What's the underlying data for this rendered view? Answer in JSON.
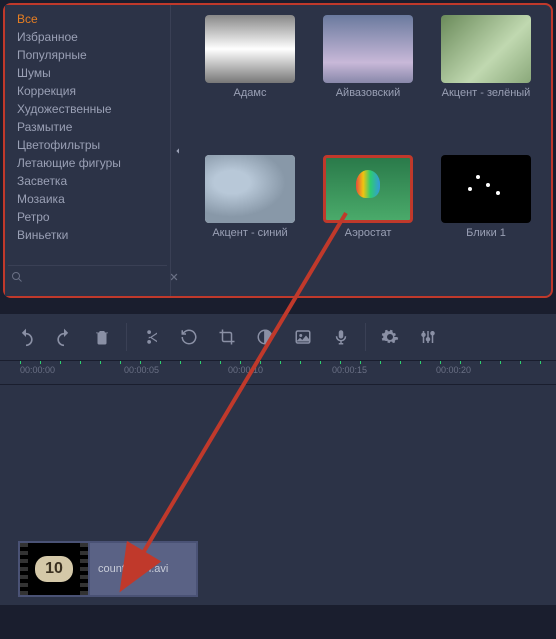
{
  "sidebar": {
    "categories": [
      {
        "label": "Все",
        "active": true
      },
      {
        "label": "Избранное",
        "active": false
      },
      {
        "label": "Популярные",
        "active": false
      },
      {
        "label": "Шумы",
        "active": false
      },
      {
        "label": "Коррекция",
        "active": false
      },
      {
        "label": "Художественные",
        "active": false
      },
      {
        "label": "Размытие",
        "active": false
      },
      {
        "label": "Цветофильтры",
        "active": false
      },
      {
        "label": "Летающие фигуры",
        "active": false
      },
      {
        "label": "Засветка",
        "active": false
      },
      {
        "label": "Мозаика",
        "active": false
      },
      {
        "label": "Ретро",
        "active": false
      },
      {
        "label": "Виньетки",
        "active": false
      }
    ]
  },
  "filters": [
    {
      "label": "Адамс",
      "selected": false
    },
    {
      "label": "Айвазовский",
      "selected": false
    },
    {
      "label": "Акцент - зелёный",
      "selected": false
    },
    {
      "label": "Акцент - синий",
      "selected": false
    },
    {
      "label": "Аэростат",
      "selected": true
    },
    {
      "label": "Блики 1",
      "selected": false
    }
  ],
  "timeline": {
    "ticks": [
      "00:00:00",
      "00:00:05",
      "00:00:10",
      "00:00:15",
      "00:00:20"
    ],
    "clip": {
      "name": "countdown.avi",
      "frame_number": "10"
    }
  }
}
